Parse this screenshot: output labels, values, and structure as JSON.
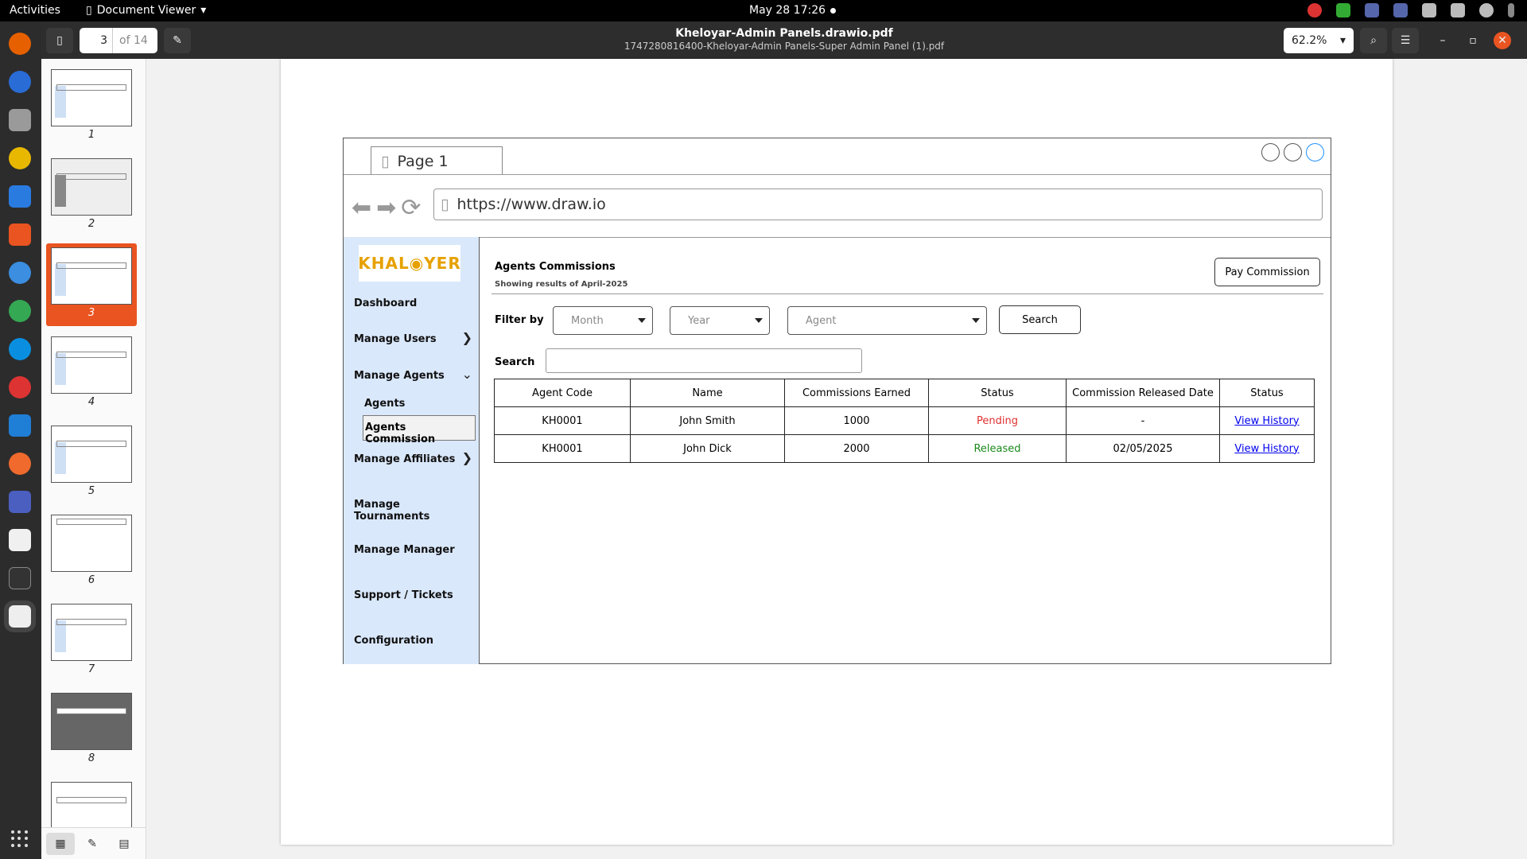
{
  "topbar": {
    "activities": "Activities",
    "app_menu": "Document Viewer",
    "clock": "May 28  17:26"
  },
  "header": {
    "page_number": "3",
    "page_of": "of 14",
    "title": "Kheloyar-Admin Panels.drawio.pdf",
    "subtitle": "1747280816400-Kheloyar-Admin Panels-Super Admin Panel (1).pdf",
    "zoom": "62.2%"
  },
  "thumbnails": [
    "1",
    "2",
    "3",
    "4",
    "5",
    "6",
    "7",
    "8"
  ],
  "mockup": {
    "tab_label": "Page 1",
    "url": "https://www.draw.io",
    "logo": "KHAL◉YER",
    "sidebar": {
      "dashboard": "Dashboard",
      "manage_users": "Manage Users",
      "manage_agents": "Manage Agents",
      "agents": "Agents",
      "agents_commission": "Agents Commission",
      "manage_affiliates": "Manage Affiliates",
      "manage_tournaments": "Manage Tournaments",
      "manage_manager": "Manage Manager",
      "support_tickets": "Support / Tickets",
      "configuration": "Configuration"
    },
    "main": {
      "title": "Agents Commissions",
      "subtitle": "Showing results of April-2025",
      "pay_button": "Pay Commission",
      "filter_label": "Filter by",
      "month": "Month",
      "year": "Year",
      "agent": "Agent",
      "search_button": "Search",
      "search_label": "Search"
    },
    "table": {
      "headers": [
        "Agent Code",
        "Name",
        "Commissions Earned",
        "Status",
        "Commission Released Date",
        "Status"
      ],
      "rows": [
        {
          "code": "KH0001",
          "name": "John Smith",
          "earned": "1000",
          "status": "Pending",
          "date": "-",
          "action": "View History"
        },
        {
          "code": "KH0001",
          "name": "John Dick",
          "earned": "2000",
          "status": "Released",
          "date": "02/05/2025",
          "action": "View History"
        }
      ]
    }
  },
  "colors": {
    "pending": "#e03030",
    "released": "#1a8a1a",
    "accent": "#e95420",
    "sidebar_bg": "#dae8fc"
  }
}
